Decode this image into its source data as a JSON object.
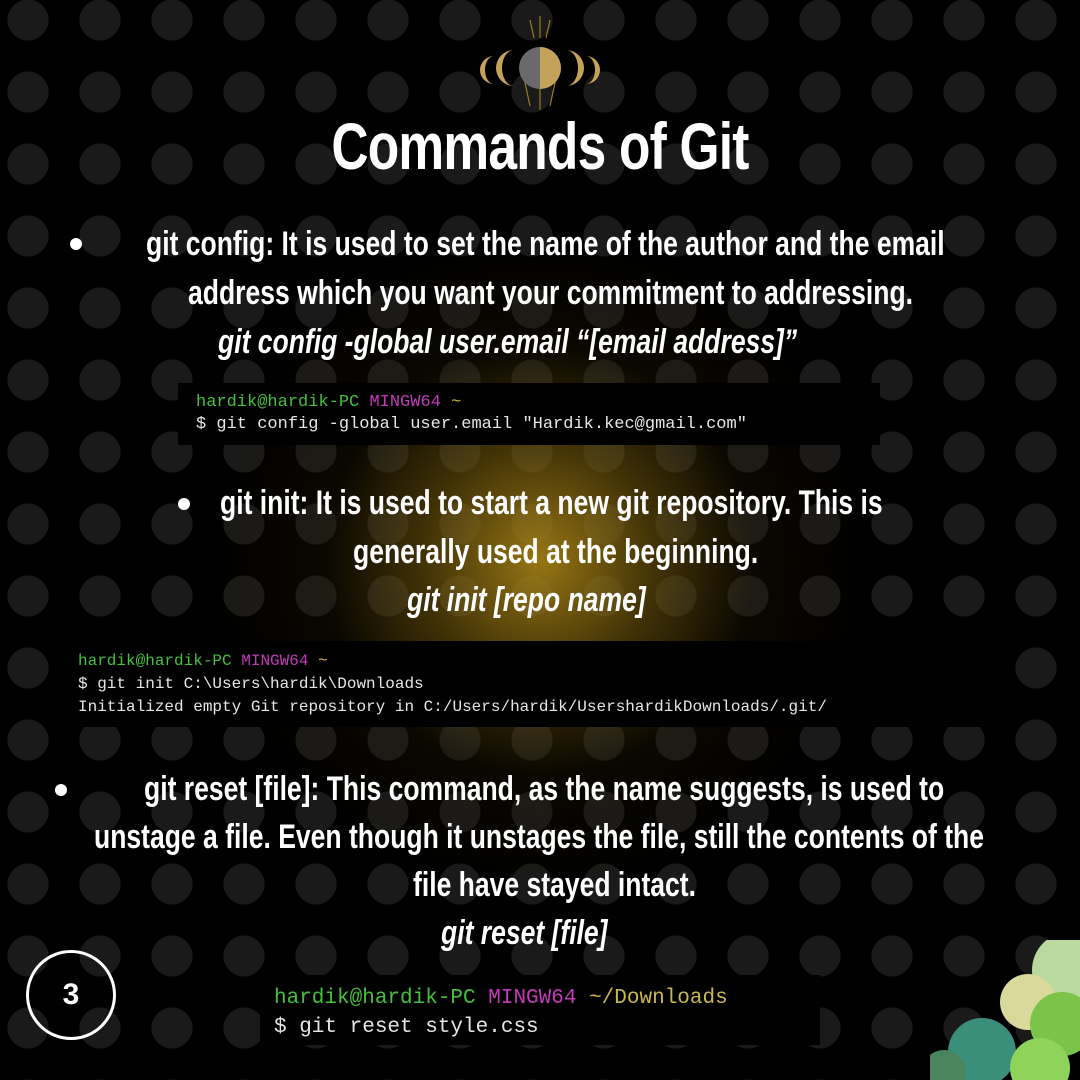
{
  "title": "Commands of Git",
  "items": [
    {
      "label": "git config:",
      "desc_lines": [
        "It is used to set the name of the author and the email",
        "address which you want your commitment to addressing."
      ],
      "command": "git config -global user.email “[email address]”",
      "terminal": [
        {
          "user": "hardik@hardik-PC",
          "env": "MINGW64",
          "path": "~"
        },
        {
          "text": "$ git config -global user.email \"Hardik.kec@gmail.com\""
        }
      ]
    },
    {
      "label": "git init:",
      "desc_lines": [
        "It is used to start a new git repository. This is",
        "generally used at the beginning."
      ],
      "command": "git init [repo name]",
      "terminal": [
        {
          "user": "hardik@hardik-PC",
          "env": "MINGW64",
          "path": "~"
        },
        {
          "text": "$ git init C:\\Users\\hardik\\Downloads"
        },
        {
          "text": "Initialized empty Git repository in C:/Users/hardik/UsershardikDownloads/.git/"
        }
      ]
    },
    {
      "label": "git reset [file]:",
      "desc_lines": [
        "This command, as the name suggests, is used to",
        "unstage a file. Even though it unstages the file, still the contents of the",
        "file have stayed intact."
      ],
      "command": "git reset [file]",
      "terminal": [
        {
          "user": "hardik@hardik-PC",
          "env": "MINGW64",
          "path": "~/Downloads"
        },
        {
          "text": "$ git reset style.css"
        }
      ]
    }
  ],
  "page_number": "3",
  "colors": {
    "accent": "#b08a18",
    "prompt_user": "#44c03c",
    "prompt_env": "#c23bb9",
    "prompt_path": "#c9b84a"
  }
}
